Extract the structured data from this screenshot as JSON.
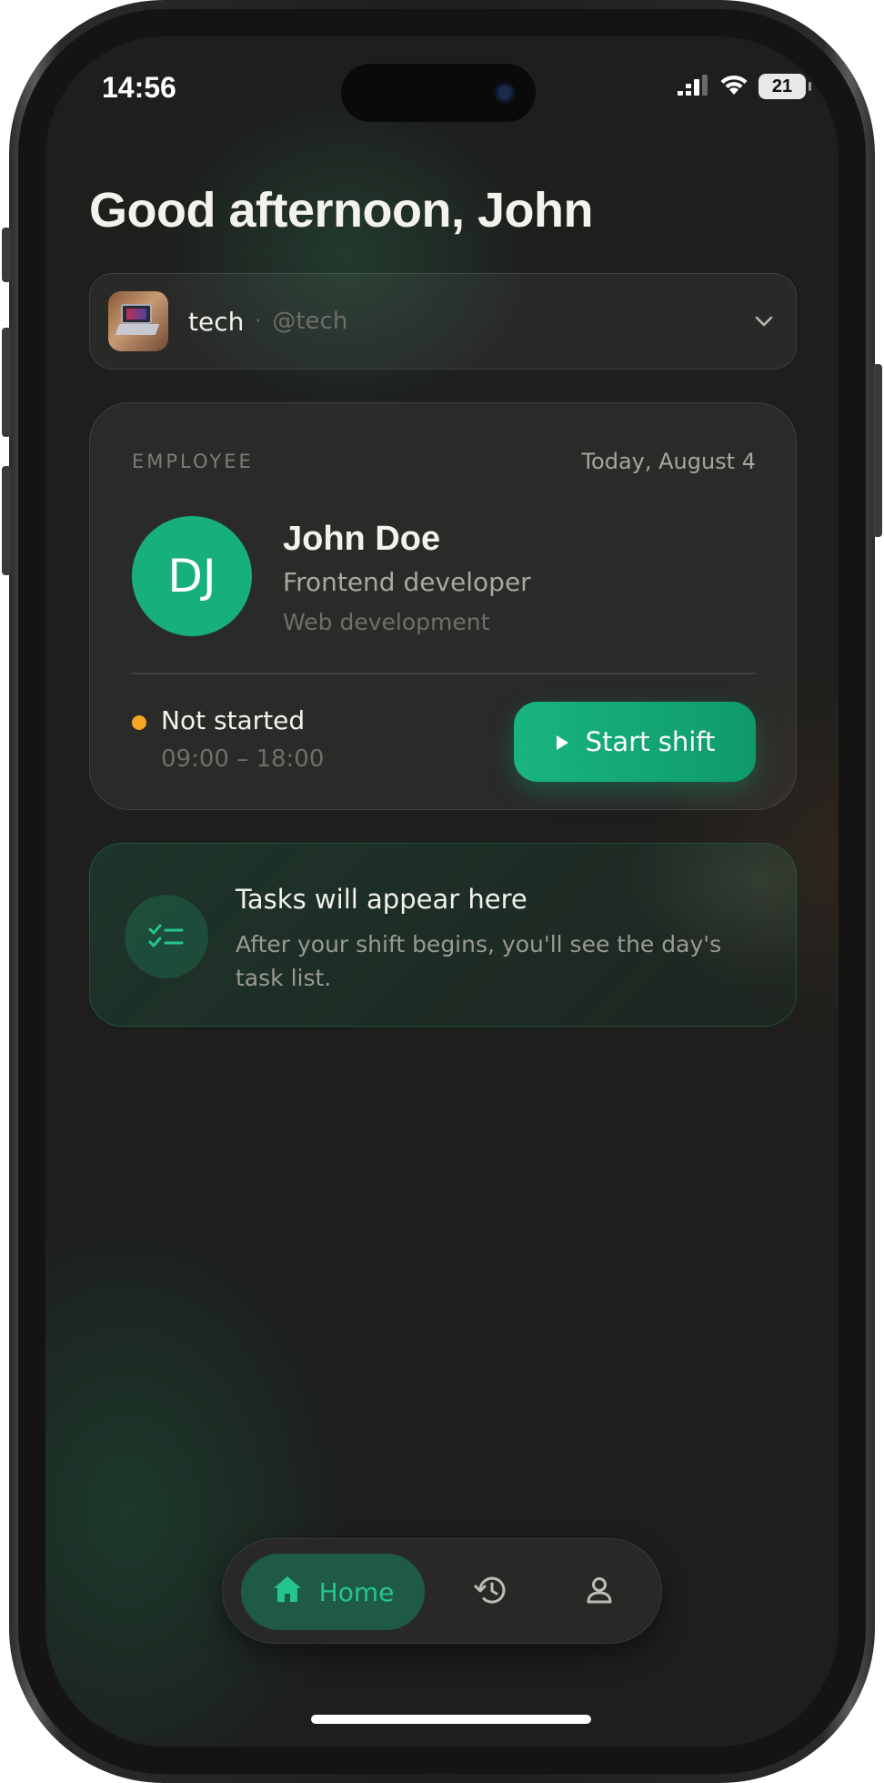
{
  "status_bar": {
    "time": "14:56",
    "battery": "21"
  },
  "greeting": "Good afternoon, John",
  "workspace": {
    "name": "tech",
    "separator": "·",
    "handle": "@tech"
  },
  "employee_card": {
    "role_label": "EMPLOYEE",
    "date": "Today, August 4",
    "avatar_initials": "DJ",
    "name": "John Doe",
    "title": "Frontend developer",
    "department": "Web development",
    "shift_status": "Not started",
    "shift_status_color": "#f5a623",
    "shift_hours": "09:00 – 18:00",
    "start_button_label": "Start shift"
  },
  "tasks_card": {
    "title": "Tasks will appear here",
    "subtitle": "After your shift begins, you'll see the day's task list."
  },
  "bottom_nav": {
    "items": [
      {
        "label": "Home",
        "icon": "home-icon",
        "active": true
      },
      {
        "label": "",
        "icon": "history-icon",
        "active": false
      },
      {
        "label": "",
        "icon": "profile-icon",
        "active": false
      }
    ]
  },
  "colors": {
    "accent": "#17b07d",
    "background": "#1e1e1c",
    "pending": "#f5a623"
  }
}
